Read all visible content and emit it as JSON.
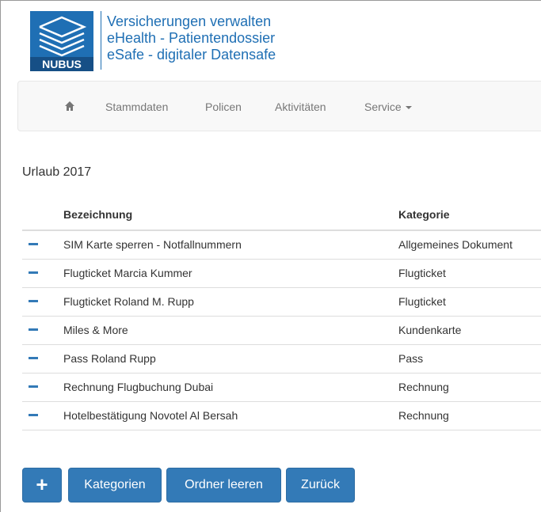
{
  "header": {
    "logo_text": "NUBUS",
    "lines": [
      "Versicherungen verwalten",
      "eHealth - Patientendossier",
      "eSafe - digitaler Datensafe"
    ]
  },
  "nav": {
    "home_icon": "home-icon",
    "items": [
      "Stammdaten",
      "Policen",
      "Aktivitäten",
      "Service"
    ]
  },
  "folder": {
    "title": "Urlaub 2017"
  },
  "table": {
    "headers": [
      "Bezeichnung",
      "Kategorie"
    ],
    "rows": [
      {
        "name": "SIM Karte sperren - Notfallnummern",
        "category": "Allgemeines Dokument"
      },
      {
        "name": "Flugticket Marcia Kummer",
        "category": "Flugticket"
      },
      {
        "name": "Flugticket Roland M. Rupp",
        "category": "Flugticket"
      },
      {
        "name": "Miles & More",
        "category": "Kundenkarte"
      },
      {
        "name": "Pass Roland Rupp",
        "category": "Pass"
      },
      {
        "name": "Rechnung Flugbuchung Dubai",
        "category": "Rechnung"
      },
      {
        "name": "Hotelbestätigung Novotel Al Bersah",
        "category": "Rechnung"
      }
    ]
  },
  "buttons": {
    "add": "+",
    "categories": "Kategorien",
    "clear": "Ordner leeren",
    "back": "Zurück"
  },
  "colors": {
    "primary": "#337ab7",
    "brand": "#1f6fb4"
  }
}
